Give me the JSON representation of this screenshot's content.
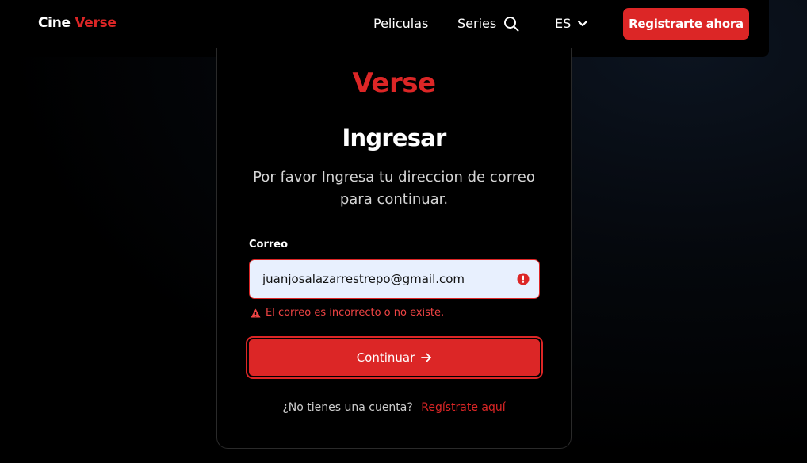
{
  "navbar": {
    "brand_first": "Cine",
    "brand_second": "Verse",
    "links": [
      "Peliculas",
      "Series"
    ],
    "language": "ES",
    "register_label": "Registrarte ahora"
  },
  "card": {
    "logo_text": "Verse",
    "title": "Ingresar",
    "subtitle": "Por favor Ingresa tu direccion de correo para continuar.",
    "email_label": "Correo",
    "email_value": "juanjosalazarrestrepo@gmail.com",
    "error_message": "El correo es incorrecto o no existe.",
    "continue_label": "Continuar",
    "signup_prompt": "¿No tienes una cuenta?",
    "signup_link": "Regístrate aquí"
  },
  "colors": {
    "accent": "#dc2626",
    "error": "#ef4444",
    "background": "#000000",
    "input_background": "#e8f0fe"
  },
  "icons": [
    "search-icon",
    "chevron-down-icon",
    "error-icon",
    "warning-icon",
    "arrow-right-icon"
  ]
}
